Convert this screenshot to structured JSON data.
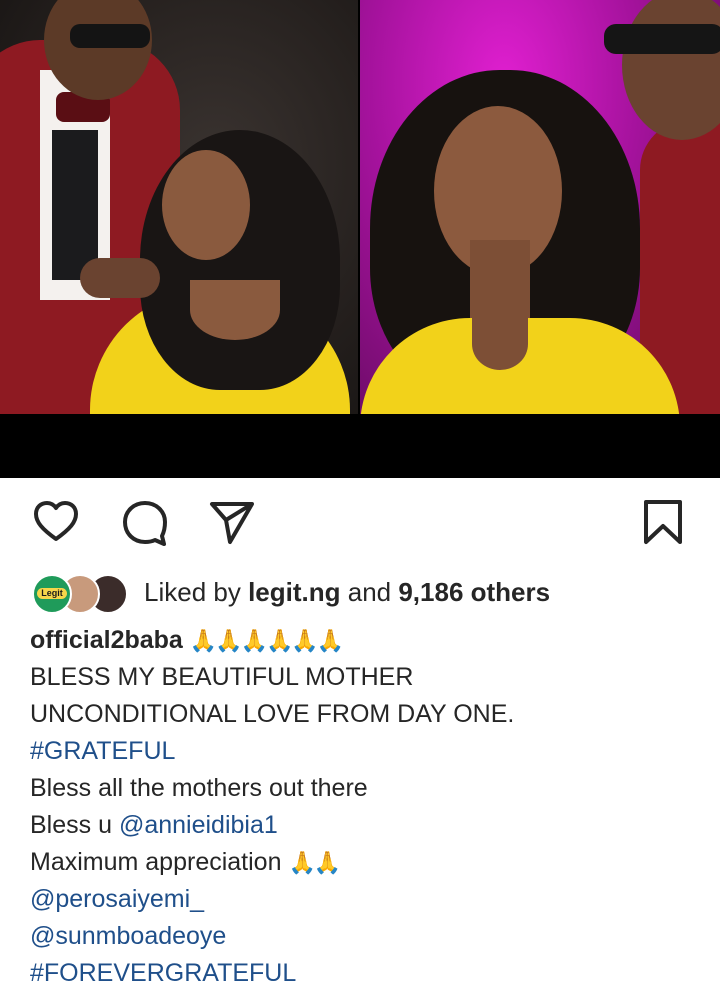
{
  "post": {
    "image": {
      "description_icon": "photo-collage"
    },
    "actions": {
      "like_icon": "heart-icon",
      "comment_icon": "comment-icon",
      "share_icon": "paper-plane-icon",
      "save_icon": "bookmark-icon"
    },
    "likes": {
      "prefix": "Liked by ",
      "first_liker": "legit.ng",
      "middle": " and ",
      "count_text": "9,186 others",
      "avatar1_text": "Legit"
    },
    "caption": {
      "username": "official2baba",
      "username_emojis": "🙏🙏🙏🙏🙏🙏",
      "line1": "BLESS MY BEAUTIFUL MOTHER",
      "line2": "UNCONDITIONAL LOVE FROM DAY ONE.",
      "hashtag1": "#GRATEFUL",
      "line4": "Bless all the mothers out there",
      "line5_prefix": "Bless u ",
      "mention1": "@annieidibia1",
      "line6": "Maximum appreciation ",
      "line6_emojis": "🙏🙏",
      "mention2": "@perosaiyemi_",
      "mention3": "@sunmboadeoye",
      "hashtag2": "#FOREVERGRATEFUL"
    }
  },
  "colors": {
    "text": "#262626",
    "link": "#1f4f8a",
    "left_bg": "#241f1d",
    "right_bg": "#a4129c",
    "yellow": "#f2d21a",
    "suit": "#8e1a22"
  }
}
